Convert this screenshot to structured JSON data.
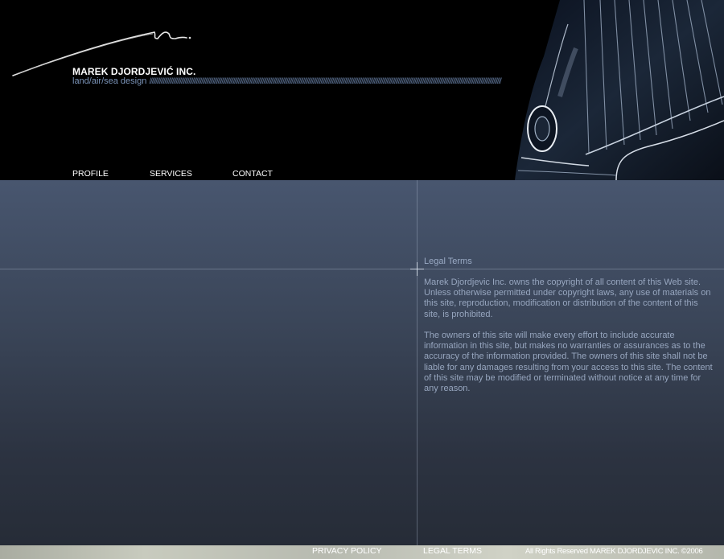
{
  "header": {
    "company_name": "MAREK DJORDJEVIĆ INC.",
    "tagline": "land/air/sea design",
    "tagline_slashes": "/////////////////////////////////////////////////////////////////////////////////////////////////////////////////////////////////////////////////////////////////////////////////////////////////////////////////////////////////////////////////////////////////////////////////////"
  },
  "nav": {
    "items": [
      {
        "label": "PROFILE"
      },
      {
        "label": "SERVICES"
      },
      {
        "label": "CONTACT"
      }
    ]
  },
  "legal": {
    "title": "Legal Terms",
    "paragraphs": [
      "Marek Djordjevic Inc. owns the copyright of all content of this Web site. Unless otherwise permitted under copyright laws, any use of materials on this site, reproduction, modification or distribution of the content of this site, is prohibited.",
      "The owners of this site will make every effort to include accurate information in this site, but makes no warranties or assurances as to the accuracy of the information provided. The owners of this site shall not be liable for any damages resulting from your access to this site. The content of this site may be modified or terminated without notice at any time for any reason."
    ]
  },
  "footer": {
    "privacy_label": "PRIVACY POLICY",
    "legal_label": "LEGAL TERMS",
    "copyright": "All Rights Reserved MAREK DJORDJEVIC INC. ©2006"
  },
  "colors": {
    "header_bg": "#000000",
    "main_gradient_top": "#48566f",
    "main_gradient_bottom": "#262c37",
    "accent_text": "#7a93b8",
    "body_text": "#97a6bf"
  }
}
